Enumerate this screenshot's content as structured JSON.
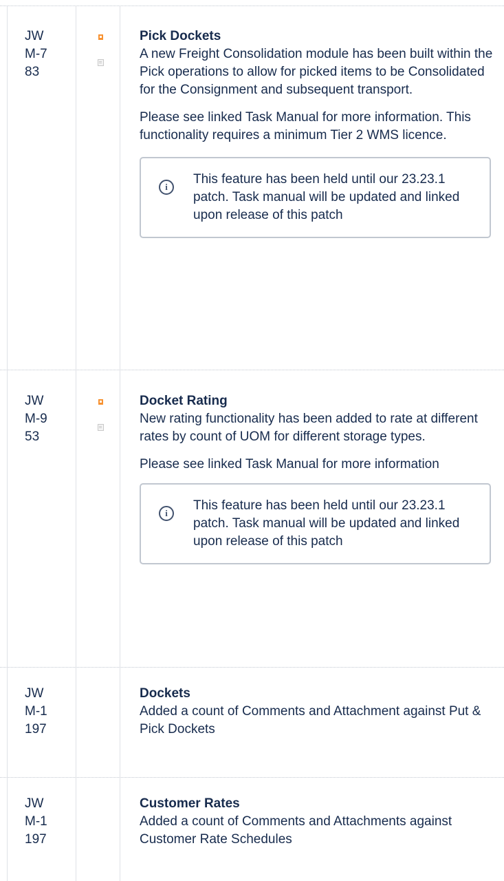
{
  "rows": [
    {
      "key": "JW\nM-7\n83",
      "title": "Pick Dockets",
      "paragraphs": [
        "A new Freight Consolidation module has been built within the Pick operations to allow for picked items to be Consolidated for the Consignment and subsequent transport.",
        "Please see linked Task Manual for more information.   This functionality requires a minimum Tier 2 WMS licence."
      ],
      "note": "This feature has been held until our 23.23.1 patch.  Task manual will be updated and linked upon release of this patch"
    },
    {
      "key": "JW\nM-9\n53",
      "title": "Docket Rating",
      "paragraphs": [
        "New rating functionality has been added to rate at different rates by count of UOM for different storage types.",
        "Please see linked Task Manual for more information"
      ],
      "note": "This feature has been held until our 23.23.1 patch.  Task manual will be updated and linked upon release of this patch"
    },
    {
      "key": "JW\nM-1\n197",
      "title": "Dockets",
      "paragraphs": [
        "Added a count of Comments and Attachment against Put & Pick Dockets"
      ]
    },
    {
      "key": "JW\nM-1\n197",
      "title": "Customer Rates",
      "paragraphs": [
        "Added a count of Comments and Attachments against Customer Rate Schedules"
      ]
    }
  ],
  "icons": {
    "bookmark": "bookmark-icon",
    "document": "document-icon",
    "info": "info-icon"
  },
  "colors": {
    "text": "#172b4d",
    "border": "#c1c7d0",
    "bookmark": "#f79232",
    "info": "#42526e"
  }
}
